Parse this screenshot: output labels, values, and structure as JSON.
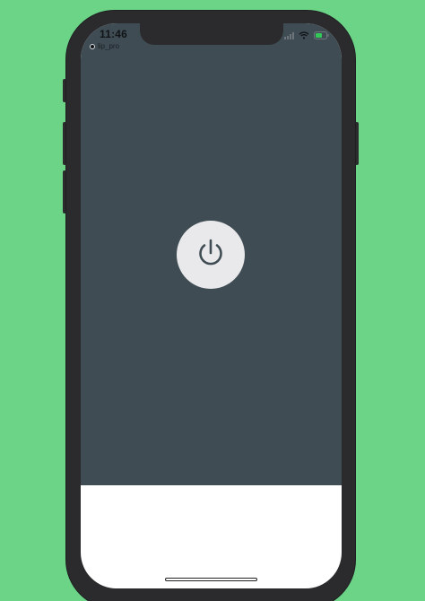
{
  "status_bar": {
    "time": "11:46",
    "icons": [
      "signal-icon",
      "wifi-icon",
      "battery-icon"
    ]
  },
  "app": {
    "label": "lip_pro"
  },
  "power_button": {
    "icon": "power-icon"
  },
  "colors": {
    "background": "#6bd487",
    "phone_frame": "#2b2b2d",
    "screen_dark": "#3f4c54",
    "button_fill": "#e9e9eb",
    "icon_color": "#3f4c54",
    "battery_fill": "#34c759"
  }
}
